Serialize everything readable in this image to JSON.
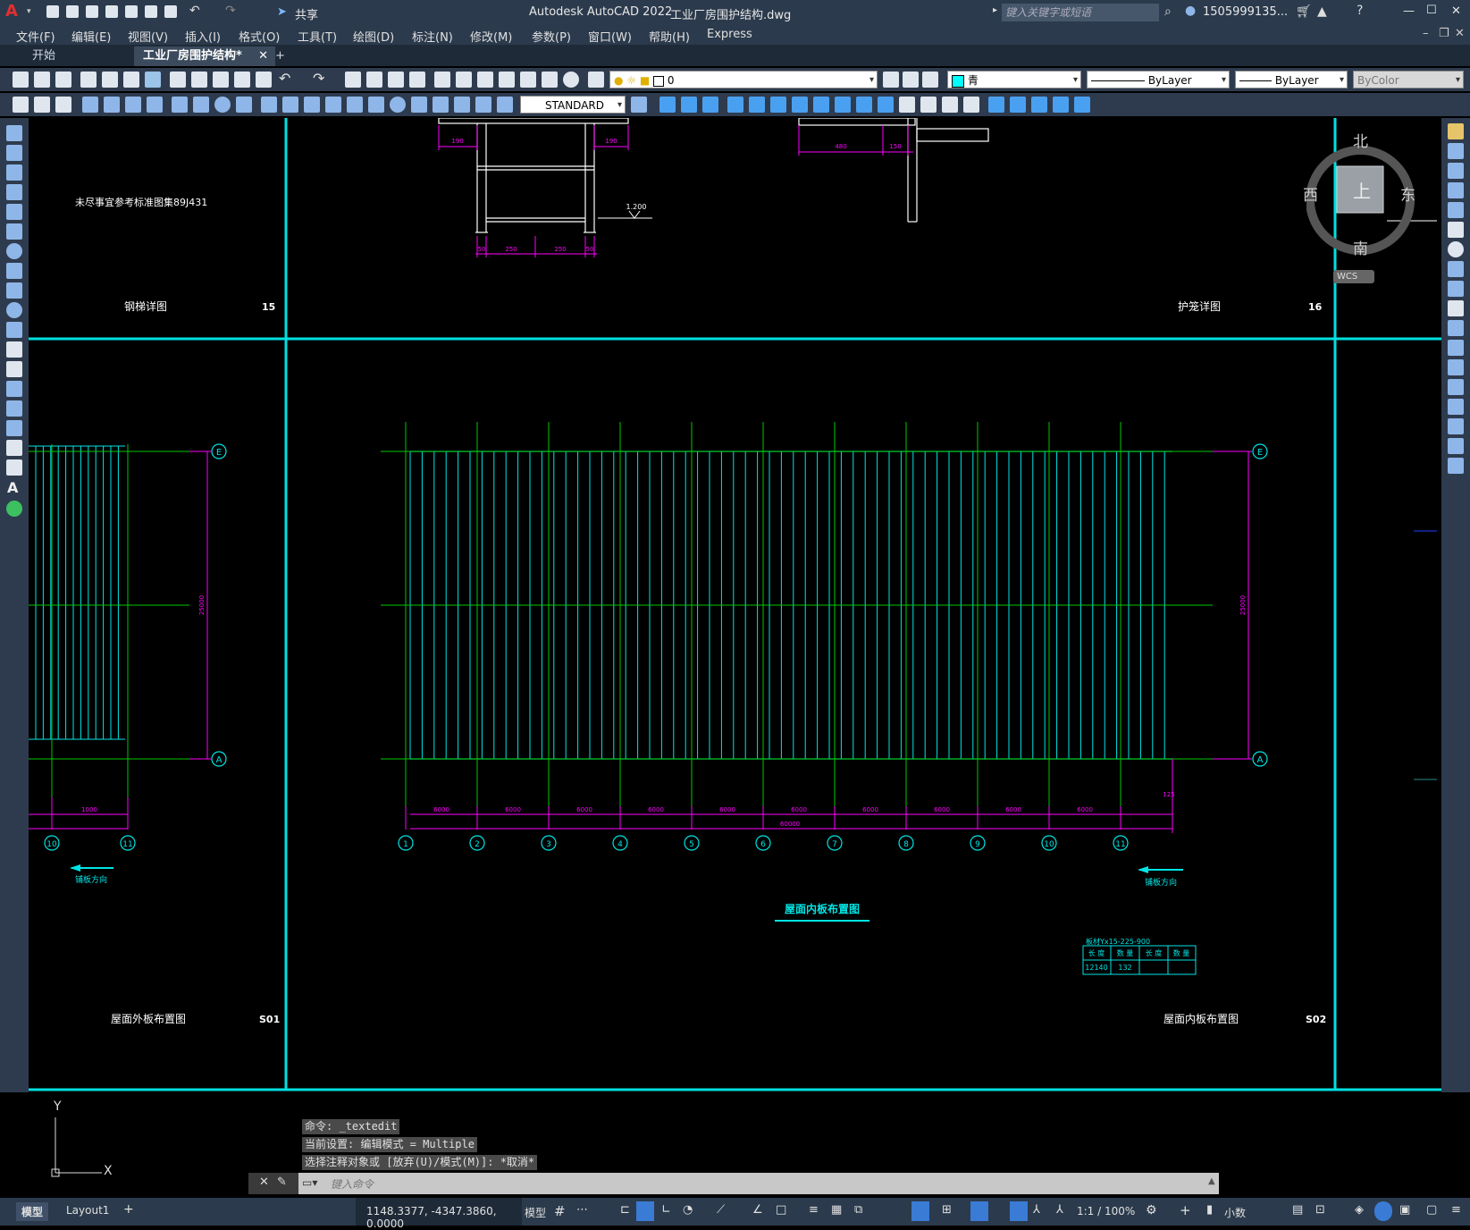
{
  "title": {
    "app": "Autodesk AutoCAD 2022",
    "file": "工业厂房围护结构.dwg",
    "share": "共享",
    "search_placeholder": "键入关键字或短语",
    "user": "1505999135...",
    "win_min": "—",
    "win_max": "☐",
    "win_close": "✕"
  },
  "menu": [
    "文件(F)",
    "编辑(E)",
    "视图(V)",
    "插入(I)",
    "格式(O)",
    "工具(T)",
    "绘图(D)",
    "标注(N)",
    "修改(M)",
    "参数(P)",
    "窗口(W)",
    "帮助(H)",
    "Express"
  ],
  "tabs": {
    "start": "开始",
    "doc": "工业厂房围护结构*",
    "close": "✕",
    "add": "+"
  },
  "toolbar": {
    "layer": "0",
    "color": "青",
    "linetype": "ByLayer",
    "lineweight": "ByLayer",
    "plotstyle": "ByColor",
    "textstyle": "STANDARD"
  },
  "viewcube": {
    "north": "北",
    "south": "南",
    "east": "东",
    "west": "西",
    "top": "上",
    "wcs": "WCS"
  },
  "drawing": {
    "ladder_label": "钢梯详图",
    "ladder_num": "15",
    "cage_label": "护笼详图",
    "cage_num": "16",
    "note": "未尽事宜参考标准图集89J431",
    "elev": "1.200",
    "dims_ladder": [
      "190",
      "190",
      "50",
      "250",
      "250",
      "50"
    ],
    "dims_cage": [
      "480",
      "150"
    ],
    "outer_label": "屋面外板布置图",
    "outer_num": "S01",
    "inner_label": "屋面内板布置图",
    "inner_num": "S02",
    "inner_title": "屋面内板布置图",
    "direction": "铺板方向",
    "axis_E": "E",
    "axis_A": "A",
    "span_dim": "25000",
    "bay_dim": "6000",
    "total_dim": "60000",
    "small_dim": "1000",
    "edge_dim": "125",
    "axes_bottom": [
      "1",
      "2",
      "3",
      "4",
      "5",
      "6",
      "7",
      "8",
      "9",
      "10",
      "11"
    ],
    "axes_left": [
      "10",
      "11"
    ],
    "table_title": "板材Yx15-225-900",
    "table_head": [
      "长 度",
      "数 量",
      "长 度",
      "数 量"
    ],
    "table_row": [
      "12140",
      "132",
      "",
      ""
    ]
  },
  "ucs": {
    "x": "X",
    "y": "Y"
  },
  "command": {
    "line1": "命令: _textedit",
    "line2": "当前设置: 编辑模式 = Multiple",
    "line3": "选择注释对象或 [放弃(U)/模式(M)]: *取消*",
    "placeholder": "键入命令"
  },
  "status": {
    "tab_model": "模型",
    "tab_layout": "Layout1",
    "coords": "1148.3377, -4347.3860, 0.0000",
    "mode": "模型",
    "scale": "1:1 / 100%",
    "units": "小数"
  },
  "colors": {
    "cyan": "#00ffff",
    "green": "#00c800",
    "magenta": "#ff00ff",
    "bg": "#000000"
  }
}
